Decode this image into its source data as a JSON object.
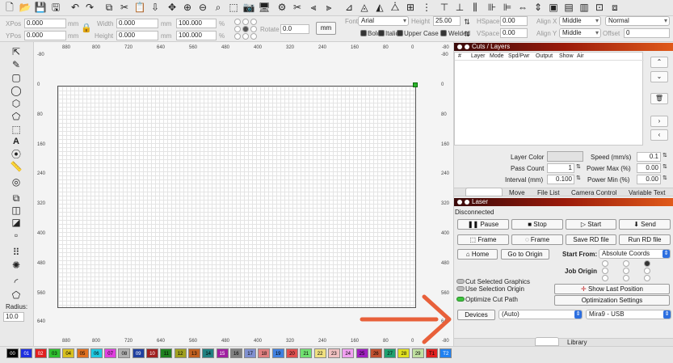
{
  "toolbar": {
    "xpos_label": "XPos",
    "xpos_value": "0.000",
    "ypos_label": "YPos",
    "ypos_value": "0.000",
    "mm1": "mm",
    "mm2": "mm",
    "mm3": "mm",
    "mm4": "mm",
    "width_label": "Width",
    "width_value": "0.000",
    "height_label": "Height",
    "height_value": "0.000",
    "scale_w": "100.000",
    "scale_h": "100.000",
    "pct1": "%",
    "pct2": "%",
    "rotate_label": "Rotate",
    "rotate_value": "0.0",
    "units_button": "mm",
    "font_label": "Font",
    "font_value": "Arial",
    "text_height_label": "Height",
    "text_height_value": "25.00",
    "hspace_label": "HSpace",
    "hspace_value": "0.00",
    "vspace_label": "VSpace",
    "vspace_value": "0.00",
    "alignx_label": "Align X",
    "alignx_value": "Middle",
    "aligny_label": "Align Y",
    "aligny_value": "Middle",
    "style_value": "Normal",
    "offset_label": "Offset",
    "offset_value": "0",
    "bold_label": "Bold",
    "italic_label": "Italic",
    "uppercase_label": "Upper Case",
    "welded_label": "Welded"
  },
  "rulers": {
    "top": [
      "880",
      "800",
      "720",
      "640",
      "560",
      "480",
      "400",
      "320",
      "240",
      "160",
      "80",
      "0",
      "-80"
    ],
    "bottom": [
      "880",
      "800",
      "720",
      "640",
      "560",
      "480",
      "400",
      "320",
      "240",
      "160",
      "80",
      "0",
      "-80"
    ],
    "left": [
      "-80",
      "0",
      "80",
      "160",
      "240",
      "320",
      "400",
      "480",
      "560",
      "640"
    ],
    "right": [
      "-80",
      "0",
      "80",
      "160",
      "240",
      "320",
      "400",
      "480",
      "560",
      "640"
    ]
  },
  "left_panel": {
    "radius_label": "Radius:",
    "radius_value": "10.0"
  },
  "cuts": {
    "title": "Cuts / Layers",
    "columns": [
      "#",
      "Layer",
      "Mode",
      "Spd/Pwr",
      "Output",
      "Show",
      "Air"
    ],
    "layer_color_label": "Layer Color",
    "speed_label": "Speed (mm/s)",
    "speed_value": "0.1",
    "pass_label": "Pass Count",
    "pass_value": "1",
    "pmax_label": "Power Max (%)",
    "pmax_value": "0.00",
    "interval_label": "Interval (mm)",
    "interval_value": "0.100",
    "pmin_label": "Power Min (%)",
    "pmin_value": "0.00",
    "tabs": [
      "Move",
      "File List",
      "Camera Control",
      "Variable Text"
    ]
  },
  "laser": {
    "title": "Laser",
    "status": "Disconnected",
    "pause": "Pause",
    "stop": "Stop",
    "start": "Start",
    "send": "Send",
    "frame1": "Frame",
    "frame2": "Frame",
    "save_rd": "Save RD file",
    "run_rd": "Run RD file",
    "home": "Home",
    "go_origin": "Go to Origin",
    "start_from_label": "Start From:",
    "start_from_value": "Absolute Coords",
    "job_origin_label": "Job Origin",
    "cut_selected": "Cut Selected Graphics",
    "use_selection": "Use Selection Origin",
    "optimize_cut": "Optimize Cut Path",
    "show_last": "Show Last Position",
    "opt_settings": "Optimization Settings",
    "devices": "Devices",
    "devices_value": "(Auto)",
    "port_value": "Mira9 - USB",
    "library_tab": "Library"
  },
  "palette": [
    {
      "label": "00",
      "color": "#000000",
      "fg": "#ffffff"
    },
    {
      "label": "01",
      "color": "#1f2fe0",
      "fg": "#ffffff"
    },
    {
      "label": "02",
      "color": "#e02020",
      "fg": "#ffffff"
    },
    {
      "label": "03",
      "color": "#2fbf2f",
      "fg": "#000000"
    },
    {
      "label": "04",
      "color": "#d8c020",
      "fg": "#000000"
    },
    {
      "label": "05",
      "color": "#e07020",
      "fg": "#000000"
    },
    {
      "label": "06",
      "color": "#20c8e0",
      "fg": "#000000"
    },
    {
      "label": "07",
      "color": "#e040e0",
      "fg": "#000000"
    },
    {
      "label": "08",
      "color": "#b0b0b0",
      "fg": "#000000"
    },
    {
      "label": "09",
      "color": "#2040a0",
      "fg": "#ffffff"
    },
    {
      "label": "10",
      "color": "#a02020",
      "fg": "#ffffff"
    },
    {
      "label": "11",
      "color": "#208020",
      "fg": "#000000"
    },
    {
      "label": "12",
      "color": "#a0a020",
      "fg": "#000000"
    },
    {
      "label": "13",
      "color": "#c06020",
      "fg": "#000000"
    },
    {
      "label": "14",
      "color": "#208080",
      "fg": "#000000"
    },
    {
      "label": "15",
      "color": "#a020a0",
      "fg": "#ffffff"
    },
    {
      "label": "16",
      "color": "#808080",
      "fg": "#000000"
    },
    {
      "label": "17",
      "color": "#8090d0",
      "fg": "#000000"
    },
    {
      "label": "18",
      "color": "#e08080",
      "fg": "#000000"
    },
    {
      "label": "19",
      "color": "#4080e0",
      "fg": "#000000"
    },
    {
      "label": "20",
      "color": "#e05050",
      "fg": "#000000"
    },
    {
      "label": "21",
      "color": "#70e070",
      "fg": "#000000"
    },
    {
      "label": "22",
      "color": "#f0e080",
      "fg": "#000000"
    },
    {
      "label": "23",
      "color": "#f0c0c0",
      "fg": "#000000"
    },
    {
      "label": "24",
      "color": "#f0a0f0",
      "fg": "#000000"
    },
    {
      "label": "25",
      "color": "#a020c0",
      "fg": "#000000"
    },
    {
      "label": "26",
      "color": "#c05030",
      "fg": "#000000"
    },
    {
      "label": "27",
      "color": "#20a070",
      "fg": "#000000"
    },
    {
      "label": "28",
      "color": "#e0e020",
      "fg": "#000000"
    },
    {
      "label": "29",
      "color": "#c0e0a0",
      "fg": "#000000"
    },
    {
      "label": "T1",
      "color": "#e02020",
      "fg": "#000000"
    },
    {
      "label": "T2",
      "color": "#2080f0",
      "fg": "#ffffff"
    }
  ],
  "annotation": {
    "arrow_color": "#e8603a"
  }
}
